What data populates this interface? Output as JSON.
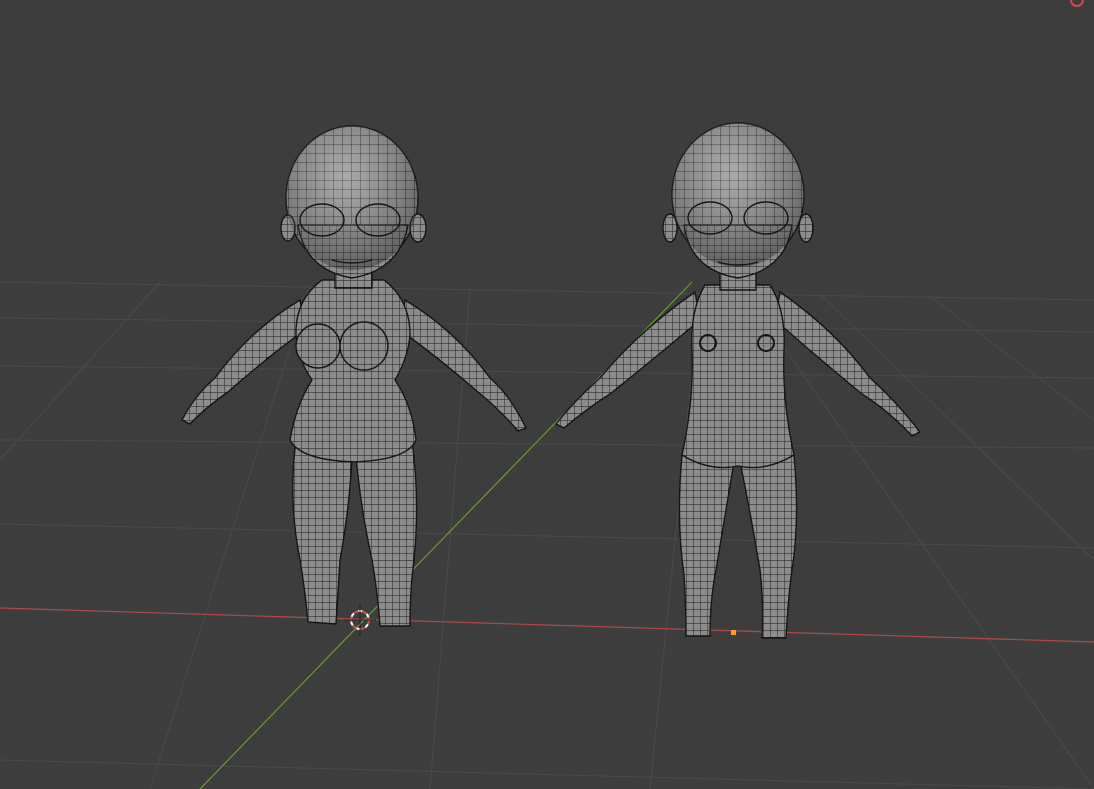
{
  "app": {
    "name": "3D Viewport",
    "shading": "wireframe-over-solid"
  },
  "scene": {
    "objects": [
      {
        "id": "chibi-female",
        "type": "mesh"
      },
      {
        "id": "chibi-male",
        "type": "mesh"
      }
    ],
    "cursor": "3d-cursor-icon",
    "origin_marker": "object-origin-dot"
  },
  "colors": {
    "background": "#3d3d3d",
    "grid_line": "#4a4a4a",
    "x_axis": "#b34a4a",
    "y_axis": "#6b9c2e",
    "mesh_fill": "#8f8f8f",
    "mesh_wire": "#161616",
    "origin_dot": "#ff9a1f",
    "cursor_ring": "#d84a4a",
    "record_indicator": "#d84a4a"
  }
}
